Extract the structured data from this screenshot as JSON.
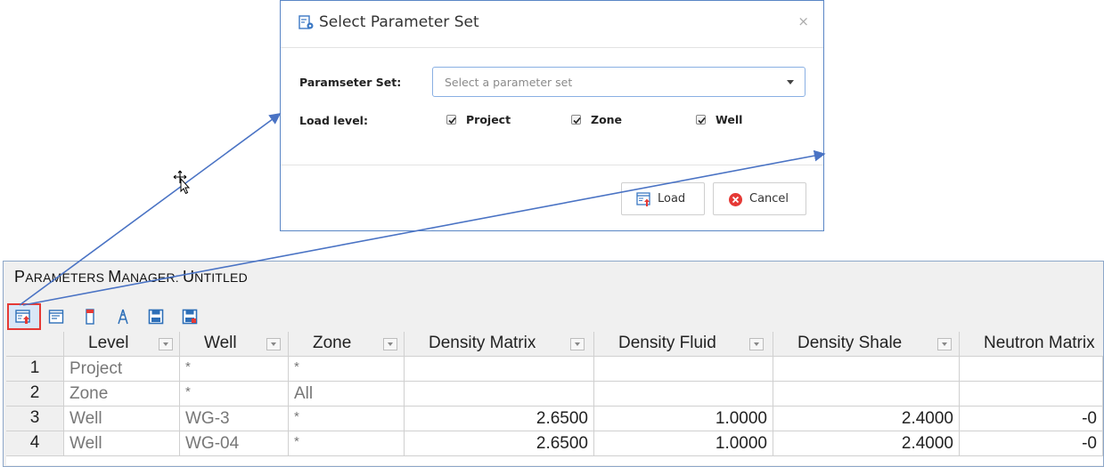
{
  "dialog": {
    "title": "Select Parameter Set",
    "close_symbol": "×",
    "param_set_label": "Paramseter Set:",
    "param_set_placeholder": "Select a parameter set",
    "load_level_label": "Load level:",
    "checkboxes": [
      {
        "label": "Project",
        "checked": true
      },
      {
        "label": "Zone",
        "checked": true
      },
      {
        "label": "Well",
        "checked": true
      }
    ],
    "load_button": "Load",
    "cancel_button": "Cancel",
    "icons": {
      "title": "parameter-set-icon",
      "load": "load-icon",
      "cancel": "cancel-circle-icon"
    }
  },
  "manager": {
    "title_parts": [
      "P",
      "ARAMETERS ",
      "M",
      "ANAGER",
      ": ",
      "U",
      "NTITLED"
    ],
    "toolbar_icons": [
      "load-parameter-set-icon",
      "properties-icon",
      "column-icon",
      "well-tower-icon",
      "save-icon",
      "save-as-icon"
    ],
    "columns": [
      "Level",
      "Well",
      "Zone",
      "Density Matrix",
      "Density Fluid",
      "Density Shale",
      "Neutron Matrix"
    ],
    "rows": [
      {
        "num": "1",
        "level": "Project",
        "well": "*",
        "zone": "*",
        "density_matrix": "",
        "density_fluid": "",
        "density_shale": "",
        "neutron_matrix": ""
      },
      {
        "num": "2",
        "level": "Zone",
        "well": "*",
        "zone": "All",
        "density_matrix": "",
        "density_fluid": "",
        "density_shale": "",
        "neutron_matrix": ""
      },
      {
        "num": "3",
        "level": "Well",
        "well": "WG-3",
        "zone": "*",
        "density_matrix": "2.6500",
        "density_fluid": "1.0000",
        "density_shale": "2.4000",
        "neutron_matrix": "-0"
      },
      {
        "num": "4",
        "level": "Well",
        "well": "WG-04",
        "zone": "*",
        "density_matrix": "2.6500",
        "density_fluid": "1.0000",
        "density_shale": "2.4000",
        "neutron_matrix": "-0"
      }
    ]
  },
  "colors": {
    "accent_border": "#5a86c5",
    "highlight": "#e53935",
    "arrow": "#4a73c4"
  }
}
